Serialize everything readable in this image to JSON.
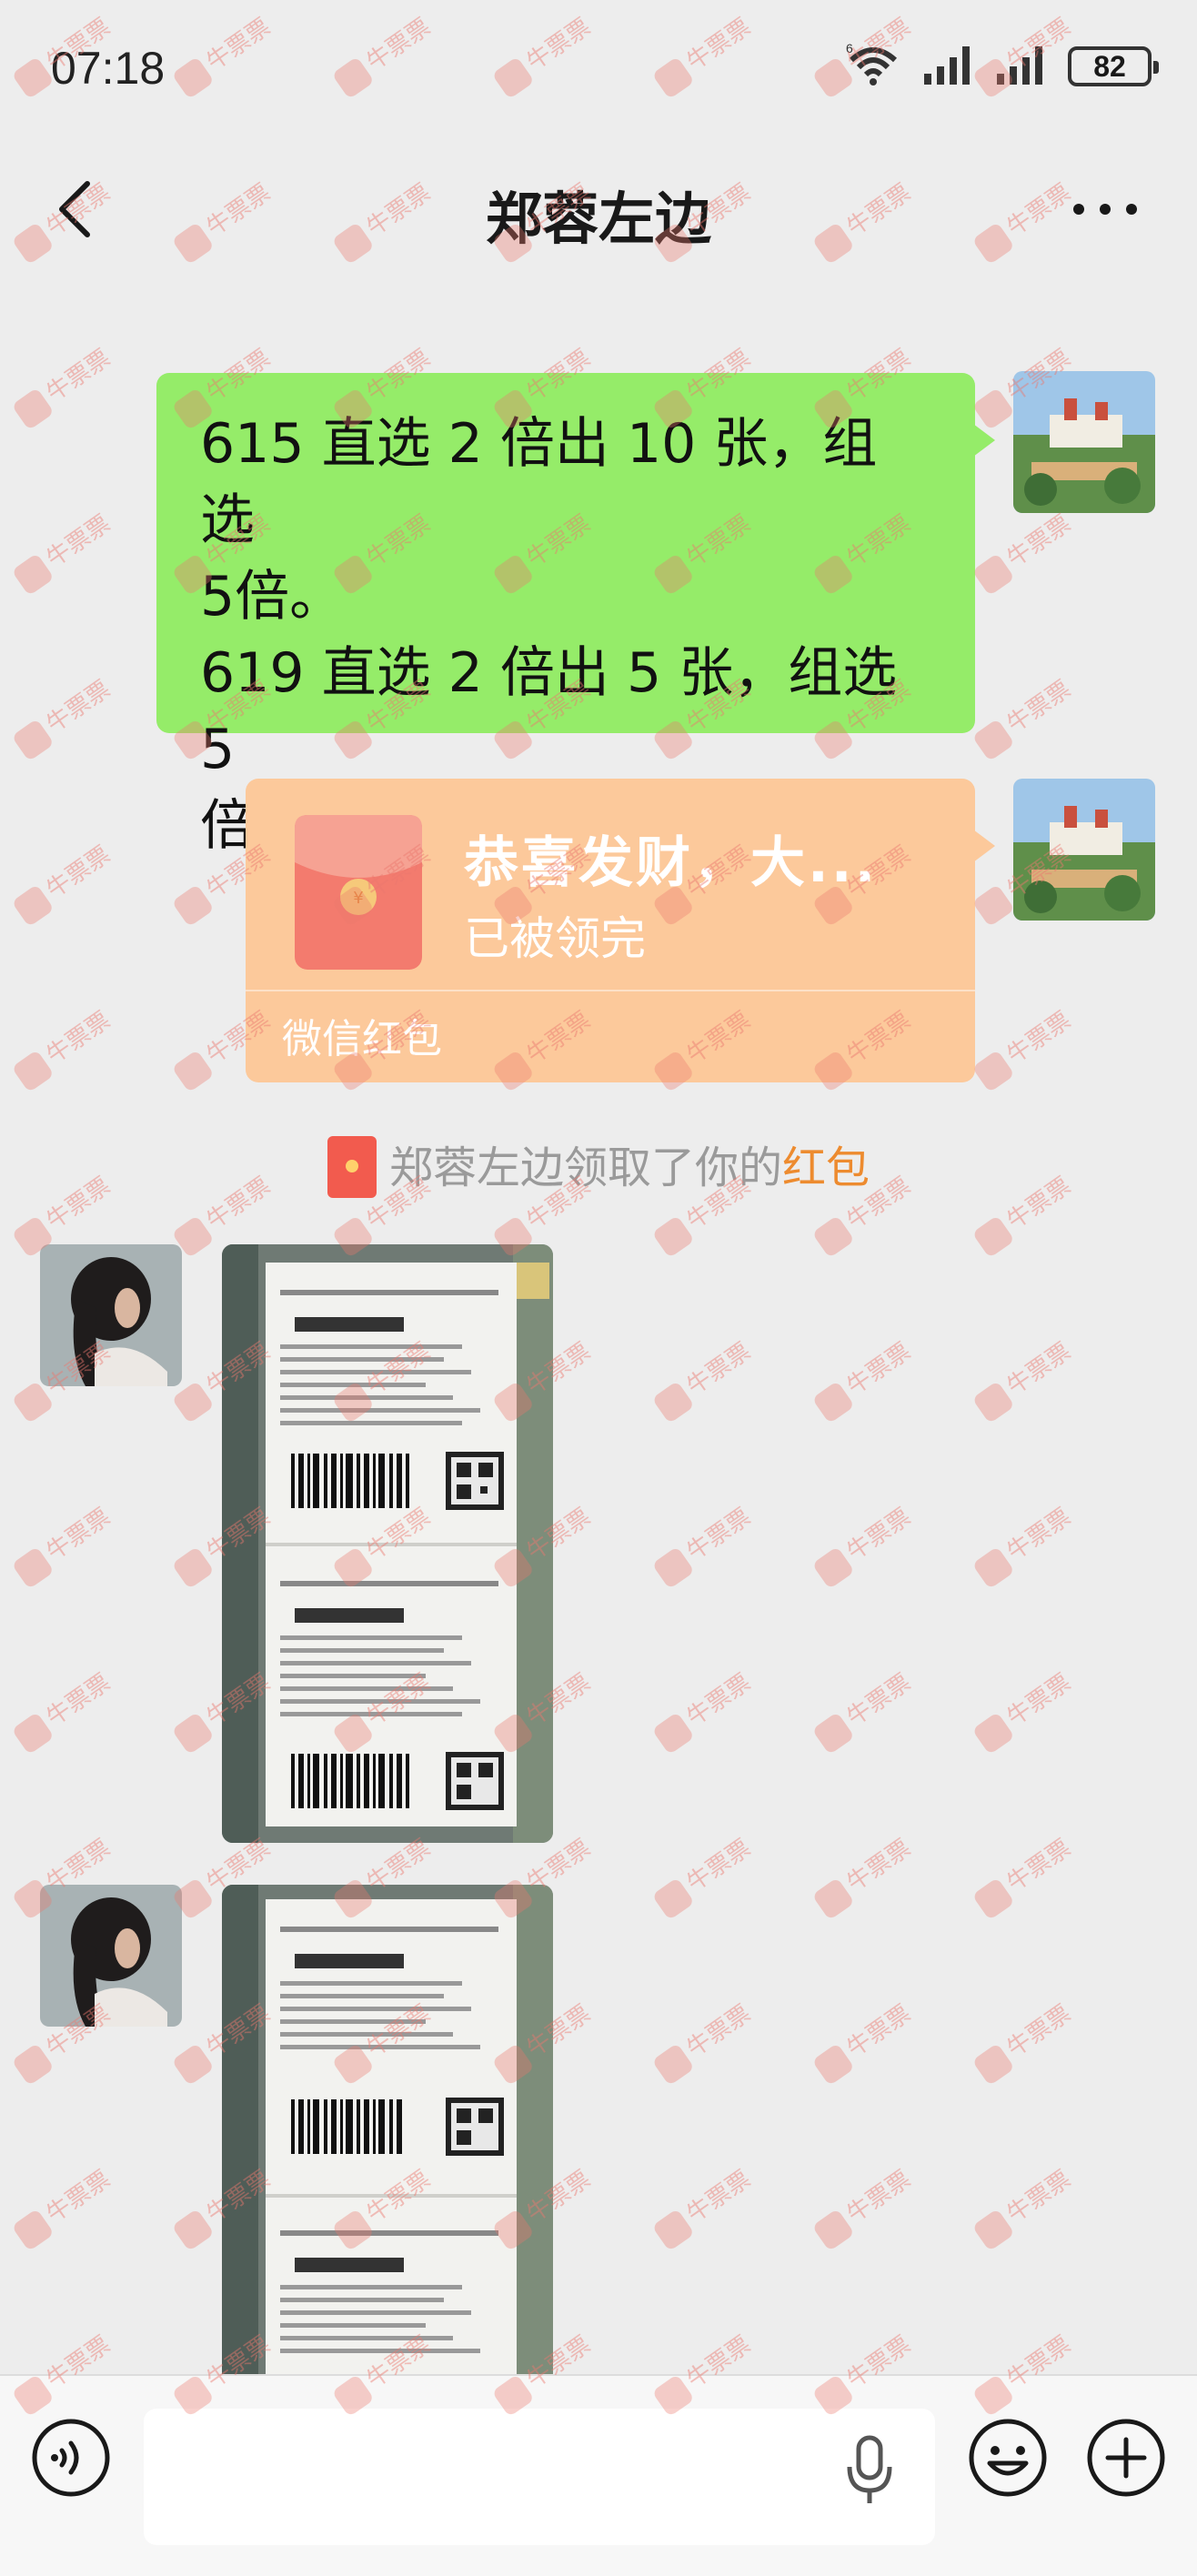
{
  "status_bar": {
    "time": "07:18",
    "battery": "82",
    "wifi_label": "6"
  },
  "header": {
    "title": "郑蓉左边"
  },
  "messages": {
    "sent_text": {
      "lines": [
        "615 直选 2 倍出 10 张，组选",
        "5倍。",
        "619 直选 2 倍出 5 张，组选 5",
        "倍。"
      ]
    },
    "red_packet": {
      "title": "恭喜发财，大...",
      "status": "已被领完",
      "label": "微信红包"
    },
    "system": {
      "text": "郑蓉左边领取了你的",
      "link": "红包"
    }
  },
  "watermark": {
    "text": "牛票票"
  },
  "colors": {
    "sent_bubble": "#95ec69",
    "red_packet": "#fcc99b",
    "link": "#ed8b2f",
    "background": "#ededed"
  }
}
